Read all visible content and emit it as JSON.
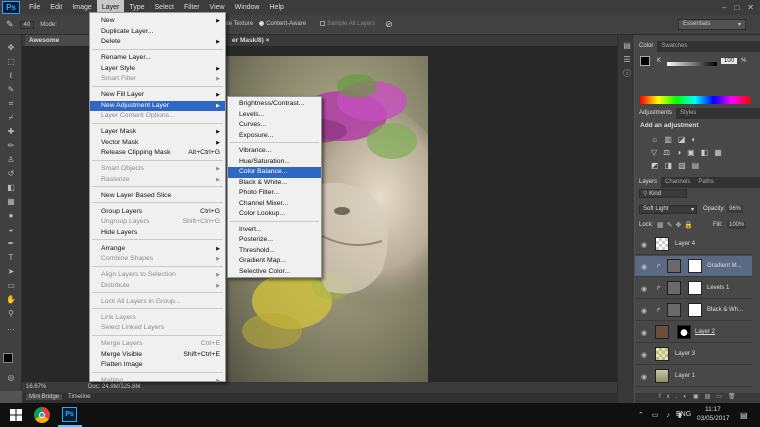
{
  "menubar": {
    "logo": "Ps",
    "items": [
      "File",
      "Edit",
      "Image",
      "Layer",
      "Type",
      "Select",
      "Filter",
      "View",
      "Window",
      "Help"
    ],
    "active_index": 3
  },
  "options": {
    "brush_size": "40",
    "mode_label": "Mode:",
    "create_texture": "Create Texture",
    "content_aware": "Content-Aware",
    "sample_all_layers": "Sample All Layers",
    "workspace": "Essentials"
  },
  "tabs": {
    "doc1": "Awesome Sleeklens Li",
    "doc2": "er Mask/8) ×"
  },
  "layer_menu": {
    "items": [
      {
        "label": "New",
        "arrow": true
      },
      {
        "label": "Duplicate Layer..."
      },
      {
        "label": "Delete",
        "arrow": true
      },
      {
        "sep": true
      },
      {
        "label": "Rename Layer..."
      },
      {
        "label": "Layer Style",
        "arrow": true
      },
      {
        "label": "Smart Filter",
        "disabled": true,
        "arrow": true
      },
      {
        "sep": true
      },
      {
        "label": "New Fill Layer",
        "arrow": true
      },
      {
        "label": "New Adjustment Layer",
        "arrow": true,
        "highlight": true
      },
      {
        "label": "Layer Content Options...",
        "disabled": true
      },
      {
        "sep": true
      },
      {
        "label": "Layer Mask",
        "arrow": true
      },
      {
        "label": "Vector Mask",
        "arrow": true
      },
      {
        "label": "Release Clipping Mask",
        "shortcut": "Alt+Ctrl+G"
      },
      {
        "sep": true
      },
      {
        "label": "Smart Objects",
        "disabled": true,
        "arrow": true
      },
      {
        "label": "Rasterize",
        "disabled": true,
        "arrow": true
      },
      {
        "sep": true
      },
      {
        "label": "New Layer Based Slice"
      },
      {
        "sep": true
      },
      {
        "label": "Group Layers",
        "shortcut": "Ctrl+G"
      },
      {
        "label": "Ungroup Layers",
        "shortcut": "Shift+Ctrl+G",
        "disabled": true
      },
      {
        "label": "Hide Layers"
      },
      {
        "sep": true
      },
      {
        "label": "Arrange",
        "arrow": true
      },
      {
        "label": "Combine Shapes",
        "disabled": true,
        "arrow": true
      },
      {
        "sep": true
      },
      {
        "label": "Align Layers to Selection",
        "disabled": true,
        "arrow": true
      },
      {
        "label": "Distribute",
        "disabled": true,
        "arrow": true
      },
      {
        "sep": true
      },
      {
        "label": "Lock All Layers in Group...",
        "disabled": true
      },
      {
        "sep": true
      },
      {
        "label": "Link Layers",
        "disabled": true
      },
      {
        "label": "Select Linked Layers",
        "disabled": true
      },
      {
        "sep": true
      },
      {
        "label": "Merge Layers",
        "shortcut": "Ctrl+E",
        "disabled": true
      },
      {
        "label": "Merge Visible",
        "shortcut": "Shift+Ctrl+E"
      },
      {
        "label": "Flatten Image"
      },
      {
        "sep": true
      },
      {
        "label": "Matting",
        "disabled": true,
        "arrow": true
      }
    ]
  },
  "adjustment_submenu": {
    "items": [
      {
        "label": "Brightness/Contrast..."
      },
      {
        "label": "Levels..."
      },
      {
        "label": "Curves..."
      },
      {
        "label": "Exposure..."
      },
      {
        "sep": true
      },
      {
        "label": "Vibrance..."
      },
      {
        "label": "Hue/Saturation..."
      },
      {
        "label": "Color Balance...",
        "highlight": true
      },
      {
        "label": "Black & White..."
      },
      {
        "label": "Photo Filter..."
      },
      {
        "label": "Channel Mixer..."
      },
      {
        "label": "Color Lookup..."
      },
      {
        "sep": true
      },
      {
        "label": "Invert..."
      },
      {
        "label": "Posterize..."
      },
      {
        "label": "Threshold..."
      },
      {
        "label": "Gradient Map..."
      },
      {
        "label": "Selective Color..."
      }
    ]
  },
  "color_panel": {
    "tabs": [
      "Color",
      "Swatches"
    ],
    "channel": "K",
    "value": "100",
    "unit": "%"
  },
  "adjustments_panel": {
    "tabs": [
      "Adjustments",
      "Styles"
    ],
    "title": "Add an adjustment"
  },
  "layers_panel": {
    "tabs": [
      "Layers",
      "Channels",
      "Paths"
    ],
    "filter": "Kind",
    "blend_mode": "Soft Light",
    "opacity_label": "Opacity:",
    "opacity": "96%",
    "lock_label": "Lock:",
    "fill_label": "Fill:",
    "fill": "100%",
    "layers": [
      {
        "name": "Layer 4"
      },
      {
        "name": "Gradient M..."
      },
      {
        "name": "Levels 1"
      },
      {
        "name": "Black & Wh..."
      },
      {
        "name": "Layer 2"
      },
      {
        "name": "Layer 3"
      },
      {
        "name": "Layer 1"
      }
    ],
    "bottom_label": "fx."
  },
  "status": {
    "zoom": "16.67%",
    "doc": "Doc: 24.9M/125.8M"
  },
  "bottom_tabs": [
    "Mini Bridge",
    "Timeline"
  ],
  "taskbar": {
    "lang": "ENG",
    "time": "11:17",
    "date": "03/05/2017"
  }
}
